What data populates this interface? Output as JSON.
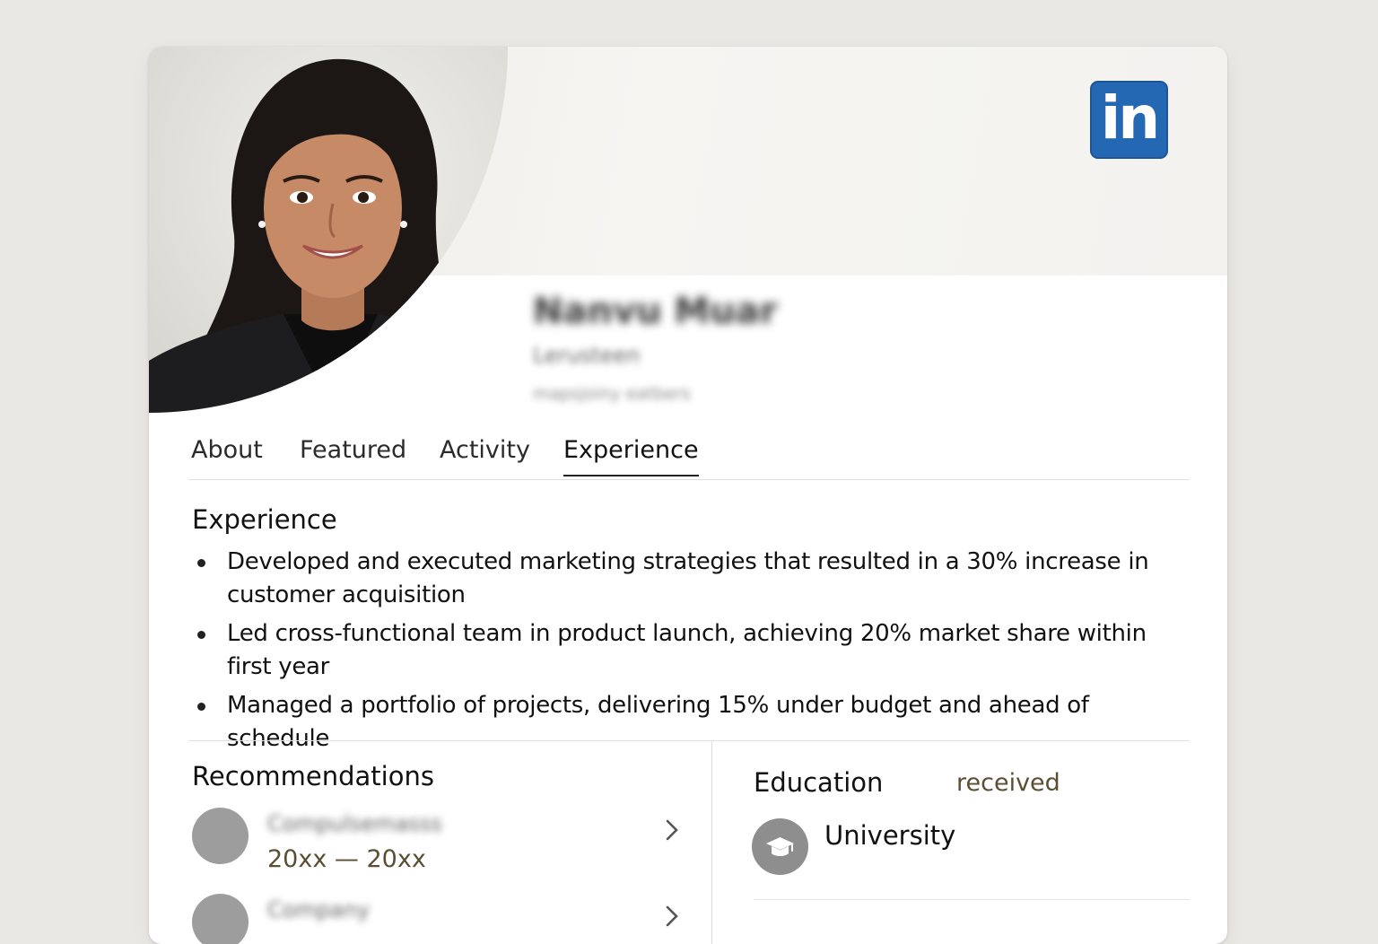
{
  "profile": {
    "name": "Nanvu Muar",
    "headline": "Lerusteen",
    "location": "mapsjoiny eatbers"
  },
  "brand": {
    "logo_text": "in",
    "color": "#2467b3"
  },
  "tabs": [
    {
      "label": "About",
      "active": false
    },
    {
      "label": "Featured",
      "active": false
    },
    {
      "label": "Activity",
      "active": false
    },
    {
      "label": "Experience",
      "active": true
    }
  ],
  "experience": {
    "title": "Experience",
    "bullets": [
      "Developed and executed marketing strategies that resulted in a 30% increase in customer acquisition",
      "Led cross-functional team in product launch, achieving 20% market share within first year",
      "Managed a portfolio of projects, delivering 15% under budget and ahead of schedule"
    ]
  },
  "recommendations": {
    "title": "Recommendations",
    "items": [
      {
        "company": "Compulsemasss",
        "dates": "20xx — 20xx"
      },
      {
        "company": "Company",
        "dates": ""
      }
    ]
  },
  "education": {
    "title": "Education",
    "status": "received",
    "school": "University",
    "icon": "graduation-cap-icon"
  }
}
